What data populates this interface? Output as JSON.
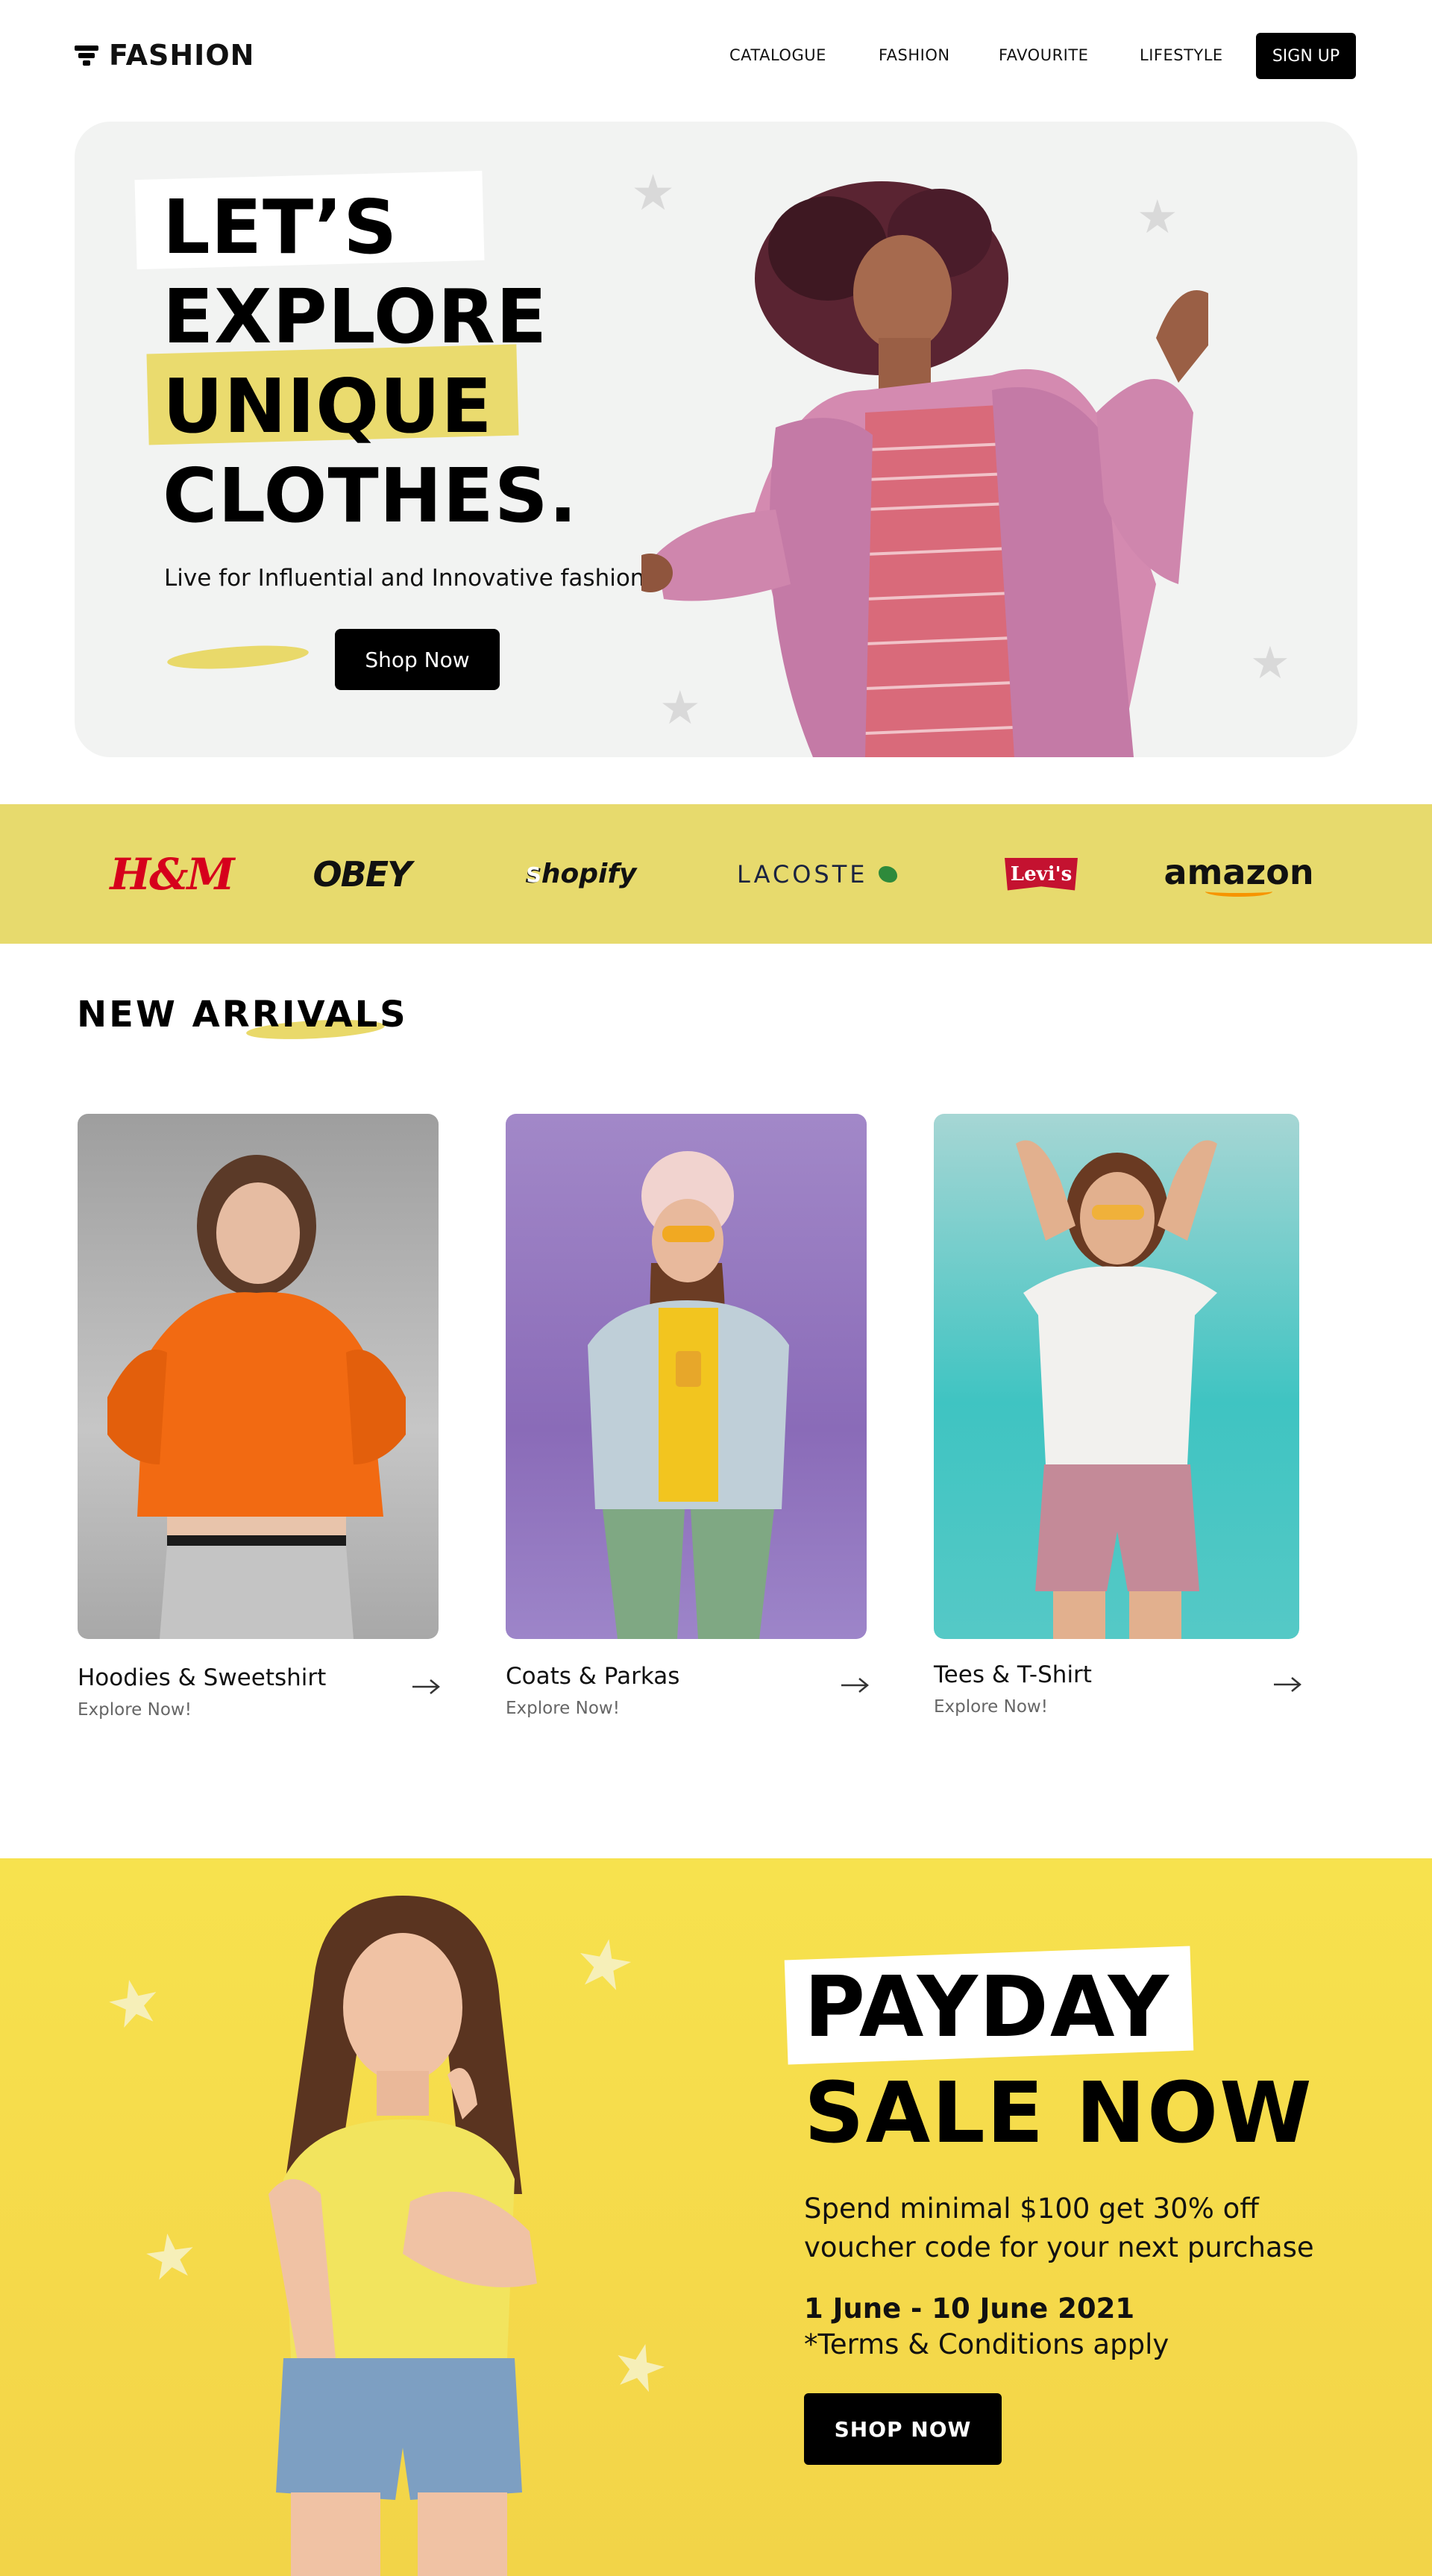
{
  "nav": {
    "logo_text": "FASHION",
    "links": [
      "CATALOGUE",
      "FASHION",
      "FAVOURITE",
      "LIFESTYLE"
    ],
    "signup_label": "SIGN UP"
  },
  "hero": {
    "lines": [
      "LET’S",
      "EXPLORE",
      "UNIQUE",
      "CLOTHES."
    ],
    "subtitle": "Live for Influential and Innovative fashion!",
    "cta_label": "Shop Now"
  },
  "brands": {
    "hm": "H&M",
    "obey": "OBEY",
    "shopify": "shopify",
    "lacoste": "LACOSTE",
    "levis": "Levi's",
    "amazon": "amazon"
  },
  "new_arrivals": {
    "title": "NEW ARRIVALS",
    "cards": [
      {
        "title": "Hoodies & Sweetshirt",
        "sub": "Explore Now!"
      },
      {
        "title": "Coats & Parkas",
        "sub": "Explore Now!"
      },
      {
        "title": "Tees & T-Shirt",
        "sub": "Explore Now!"
      }
    ]
  },
  "payday": {
    "line1": "PAYDAY",
    "line2": "SALE NOW",
    "offer": "Spend minimal $100 get 30% off voucher code for your next purchase",
    "dates": "1 June - 10 June 2021",
    "terms": "*Terms & Conditions apply",
    "cta_label": "SHOP NOW"
  },
  "colors": {
    "accent_yellow": "#e7da6d",
    "payday_yellow": "#f6de4c",
    "button_black": "#000000",
    "hero_bg": "#f2f3f2"
  }
}
